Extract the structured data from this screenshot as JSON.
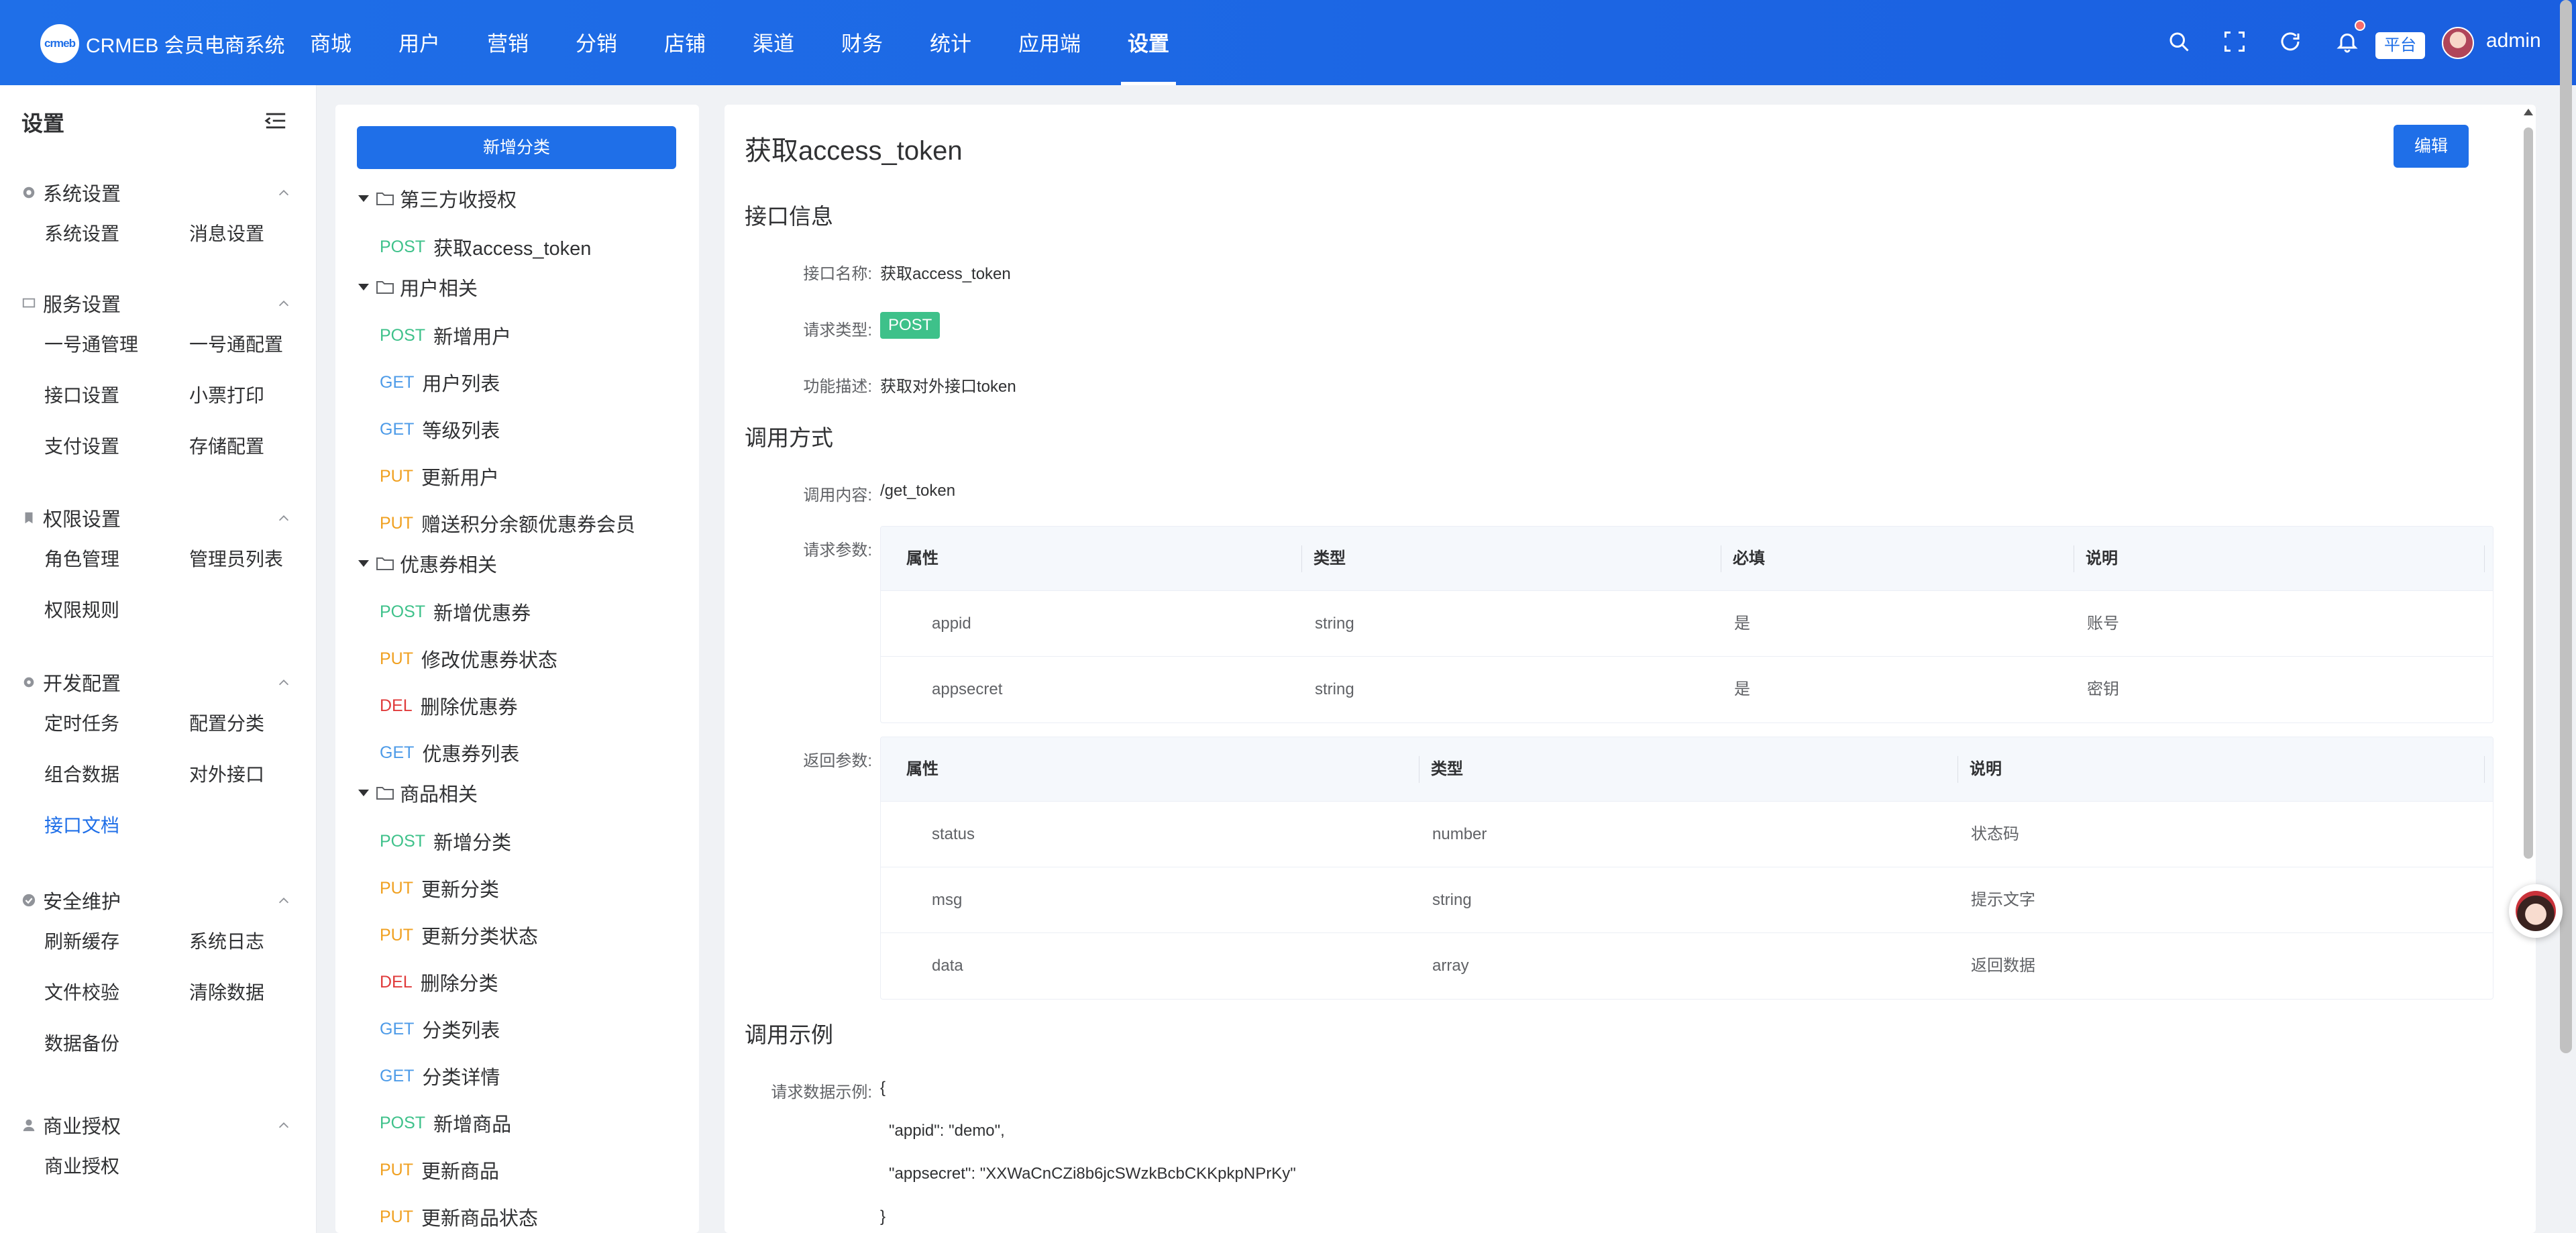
{
  "header": {
    "logo_mark": "crmeb",
    "logo_text": "CRMEB 会员电商系统",
    "nav": [
      "商城",
      "用户",
      "营销",
      "分销",
      "店铺",
      "渠道",
      "财务",
      "统计",
      "应用端",
      "设置"
    ],
    "active_nav": "设置",
    "platform_label": "平台",
    "user_name": "admin",
    "icons": [
      "search-icon",
      "fullscreen-icon",
      "refresh-icon",
      "bell-icon"
    ]
  },
  "sidebar": {
    "title": "设置",
    "groups": [
      {
        "label": "系统设置",
        "icon": "gear-icon",
        "items": [
          "系统设置",
          "消息设置"
        ]
      },
      {
        "label": "服务设置",
        "icon": "monitor-icon",
        "items": [
          "一号通管理",
          "一号通配置",
          "接口设置",
          "小票打印",
          "支付设置",
          "存储配置"
        ]
      },
      {
        "label": "权限设置",
        "icon": "bookmark-icon",
        "items": [
          "角色管理",
          "管理员列表",
          "权限规则"
        ]
      },
      {
        "label": "开发配置",
        "icon": "cog-icon",
        "items": [
          "定时任务",
          "配置分类",
          "组合数据",
          "对外接口",
          "接口文档"
        ]
      },
      {
        "label": "安全维护",
        "icon": "check-circle-icon",
        "items": [
          "刷新缓存",
          "系统日志",
          "文件校验",
          "清除数据",
          "数据备份"
        ]
      },
      {
        "label": "商业授权",
        "icon": "user-icon",
        "items": [
          "商业授权"
        ]
      }
    ],
    "active_item": "接口文档"
  },
  "tree": {
    "add_button": "新增分类",
    "nodes": [
      {
        "type": "folder",
        "label": "第三方收授权"
      },
      {
        "type": "leaf",
        "method": "POST",
        "label": "获取access_token",
        "selected": true
      },
      {
        "type": "folder",
        "label": "用户相关"
      },
      {
        "type": "leaf",
        "method": "POST",
        "label": "新增用户"
      },
      {
        "type": "leaf",
        "method": "GET",
        "label": "用户列表"
      },
      {
        "type": "leaf",
        "method": "GET",
        "label": "等级列表"
      },
      {
        "type": "leaf",
        "method": "PUT",
        "label": "更新用户"
      },
      {
        "type": "leaf",
        "method": "PUT",
        "label": "赠送积分余额优惠券会员"
      },
      {
        "type": "folder",
        "label": "优惠券相关"
      },
      {
        "type": "leaf",
        "method": "POST",
        "label": "新增优惠券"
      },
      {
        "type": "leaf",
        "method": "PUT",
        "label": "修改优惠券状态"
      },
      {
        "type": "leaf",
        "method": "DEL",
        "label": "删除优惠券"
      },
      {
        "type": "leaf",
        "method": "GET",
        "label": "优惠券列表"
      },
      {
        "type": "folder",
        "label": "商品相关"
      },
      {
        "type": "leaf",
        "method": "POST",
        "label": "新增分类"
      },
      {
        "type": "leaf",
        "method": "PUT",
        "label": "更新分类"
      },
      {
        "type": "leaf",
        "method": "PUT",
        "label": "更新分类状态"
      },
      {
        "type": "leaf",
        "method": "DEL",
        "label": "删除分类"
      },
      {
        "type": "leaf",
        "method": "GET",
        "label": "分类列表"
      },
      {
        "type": "leaf",
        "method": "GET",
        "label": "分类详情"
      },
      {
        "type": "leaf",
        "method": "POST",
        "label": "新增商品"
      },
      {
        "type": "leaf",
        "method": "PUT",
        "label": "更新商品"
      },
      {
        "type": "leaf",
        "method": "PUT",
        "label": "更新商品状态"
      }
    ]
  },
  "detail": {
    "title": "获取access_token",
    "edit_button": "编辑",
    "section_info": "接口信息",
    "label_name": "接口名称:",
    "value_name": "获取access_token",
    "label_type": "请求类型:",
    "value_type": "POST",
    "label_desc": "功能描述:",
    "value_desc": "获取对外接口token",
    "section_call": "调用方式",
    "label_content": "调用内容:",
    "value_content": "/get_token",
    "label_req": "请求参数:",
    "req_headers": [
      "属性",
      "类型",
      "必填",
      "说明"
    ],
    "req_rows": [
      [
        "appid",
        "string",
        "是",
        "账号"
      ],
      [
        "appsecret",
        "string",
        "是",
        "密钥"
      ]
    ],
    "label_resp": "返回参数:",
    "resp_headers": [
      "属性",
      "类型",
      "说明"
    ],
    "resp_rows": [
      [
        "status",
        "number",
        "状态码"
      ],
      [
        "msg",
        "string",
        "提示文字"
      ],
      [
        "data",
        "array",
        "返回数据"
      ]
    ],
    "section_example": "调用示例",
    "label_example": "请求数据示例:",
    "code_lines": [
      "{",
      "\"appid\": \"demo\",",
      "\"appsecret\": \"XXWaCnCZi8b6jcSWzkBcbCKKpkpNPrKy\"",
      "}"
    ]
  },
  "colors": {
    "primary": "#1f6fe8",
    "post": "#3ec18a",
    "get": "#4d9be8",
    "put": "#f0a020",
    "del": "#e03b3b"
  }
}
